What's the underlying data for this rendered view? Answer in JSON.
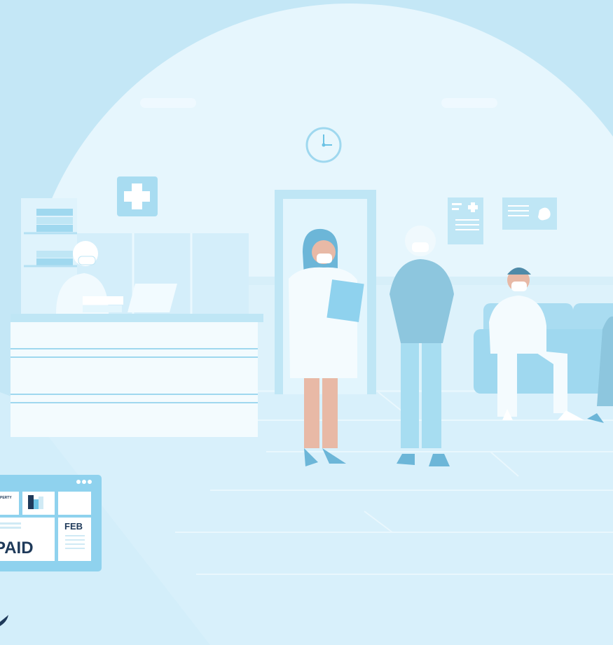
{
  "colors": {
    "background": "#c4e7f6",
    "circle": "#e6f6fd",
    "floor": "#d8f0fb",
    "wall_light": "#eef9fe",
    "accent": "#9fd8ef",
    "accent_dark": "#6cc3e5",
    "navy": "#1f3a5a",
    "skin": "#e8b9a6",
    "card_frame": "#8fd2ee",
    "card_panel": "#ffffff"
  },
  "illustration": {
    "clock_icon": "clock-icon",
    "medical_cross_icon": "medical-cross-icon",
    "poster_icon": "medical-poster-icon",
    "stomach_sign_icon": "stomach-sign-icon"
  },
  "invoice_card": {
    "menu_icon": "ellipsis-icon",
    "property_label": "PERTY",
    "chart_icon": "bar-chart-icon",
    "status_text": "PAID",
    "month_label": "FEB"
  }
}
